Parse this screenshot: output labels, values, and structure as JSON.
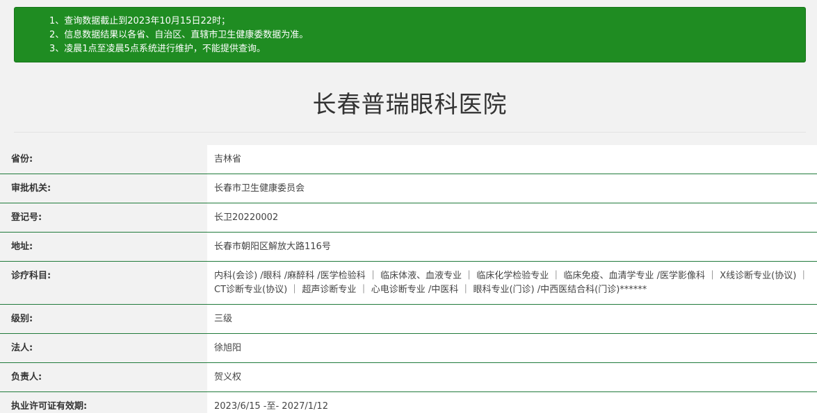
{
  "notice": {
    "line1": "1、查询数据截止到2023年10月15日22时；",
    "line2": "2、信息数据结果以各省、自治区、直辖市卫生健康委数据为准。",
    "line3": "3、凌晨1点至凌晨5点系统进行维护，不能提供查询。",
    "background_color": "#1f8c22"
  },
  "hospital_name": "长春普瑞眼科医院",
  "fields": [
    {
      "label": "省份:",
      "value": "吉林省"
    },
    {
      "label": "审批机关:",
      "value": "长春市卫生健康委员会"
    },
    {
      "label": "登记号:",
      "value": "长卫20220002"
    },
    {
      "label": "地址:",
      "value": "长春市朝阳区解放大路116号"
    },
    {
      "label": "诊疗科目:",
      "value": "内科(会诊) /眼科 /麻醉科 /医学检验科 ｜ 临床体液、血液专业 ｜ 临床化学检验专业 ｜ 临床免疫、血清学专业 /医学影像科 ｜ X线诊断专业(协议) ｜ CT诊断专业(协议) ｜ 超声诊断专业 ｜ 心电诊断专业 /中医科 ｜ 眼科专业(门诊) /中西医结合科(门诊)******"
    },
    {
      "label": "级别:",
      "value": "三级"
    },
    {
      "label": "法人:",
      "value": "徐旭阳"
    },
    {
      "label": "负责人:",
      "value": "贺义权"
    },
    {
      "label": "执业许可证有效期:",
      "value": "2023/6/15 -至- 2027/1/12"
    }
  ],
  "row_border_color": "#1f7a3a"
}
